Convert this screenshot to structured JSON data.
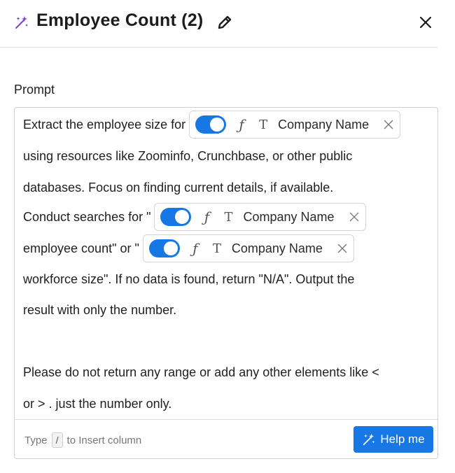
{
  "header": {
    "title": "Employee Count (2)"
  },
  "prompt": {
    "label": "Prompt",
    "lines": {
      "l1_text": "Extract the employee size for ",
      "l2_text": "using resources like Zoominfo, Crunchbase, or other public",
      "l3_text": "databases. Focus on finding current details, if available.",
      "l4_text": "Conduct searches for \" ",
      "l5_text": "employee count\" or \" ",
      "l6_text": "workforce size\". If no data is found, return \"N/A\". Output the",
      "l7_text": "result with only the number.",
      "l8_text": "Please do not return any range or add any other elements like <",
      "l9_text": "or > . just the number only."
    },
    "chips": [
      {
        "column": "Company Name",
        "toggle_on": true,
        "fx_glyph": "ƒ",
        "type_glyph": "T"
      },
      {
        "column": "Company Name",
        "toggle_on": true,
        "fx_glyph": "ƒ",
        "type_glyph": "T"
      },
      {
        "column": "Company Name",
        "toggle_on": true,
        "fx_glyph": "ƒ",
        "type_glyph": "T"
      }
    ]
  },
  "footer": {
    "hint_prefix": "Type",
    "hint_key": "/",
    "hint_suffix": "to Insert column",
    "help_label": "Help me"
  },
  "colors": {
    "accent": "#1677e5",
    "magic_icon": "#7b3fe4"
  },
  "icons": {
    "title": "magic-wand-icon",
    "edit": "pencil-icon",
    "close": "close-icon",
    "chip_remove": "close-icon",
    "help": "magic-wand-icon"
  }
}
